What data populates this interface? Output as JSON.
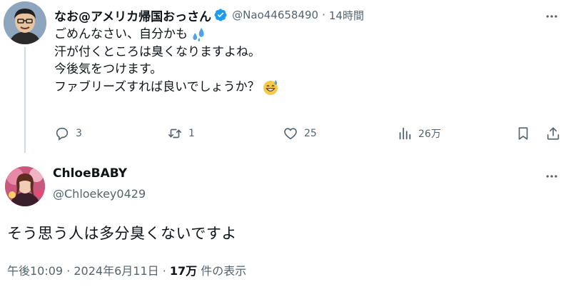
{
  "reply": {
    "display_name": "なお@アメリカ帰国おっさん",
    "handle": "@Nao44658490",
    "separator": "·",
    "time": "14時間",
    "lines": [
      "ごめんなさい、自分かも",
      "汗が付くところは臭くなりますよね。",
      "今後気をつけます。",
      "ファブリーズすれば良いでしょうか？"
    ],
    "line1_emoji": "sweat-droplets-icon",
    "line4_emoji": "grinning-face-with-sweat-icon",
    "actions": {
      "replies": "3",
      "retweets": "1",
      "likes": "25",
      "views": "26万"
    }
  },
  "main": {
    "display_name": "ChloeBABY",
    "handle": "@Chloekey0429",
    "text": "そう思う人は多分臭くないですよ",
    "timestamp": "午後10:09 · 2024年6月11日 · ",
    "views_count": "17万",
    "views_suffix": " 件の表示"
  },
  "colors": {
    "text_primary": "#0f1419",
    "text_secondary": "#536471",
    "verified_blue": "#1d9bf0",
    "thread_line": "#cfd9de"
  }
}
